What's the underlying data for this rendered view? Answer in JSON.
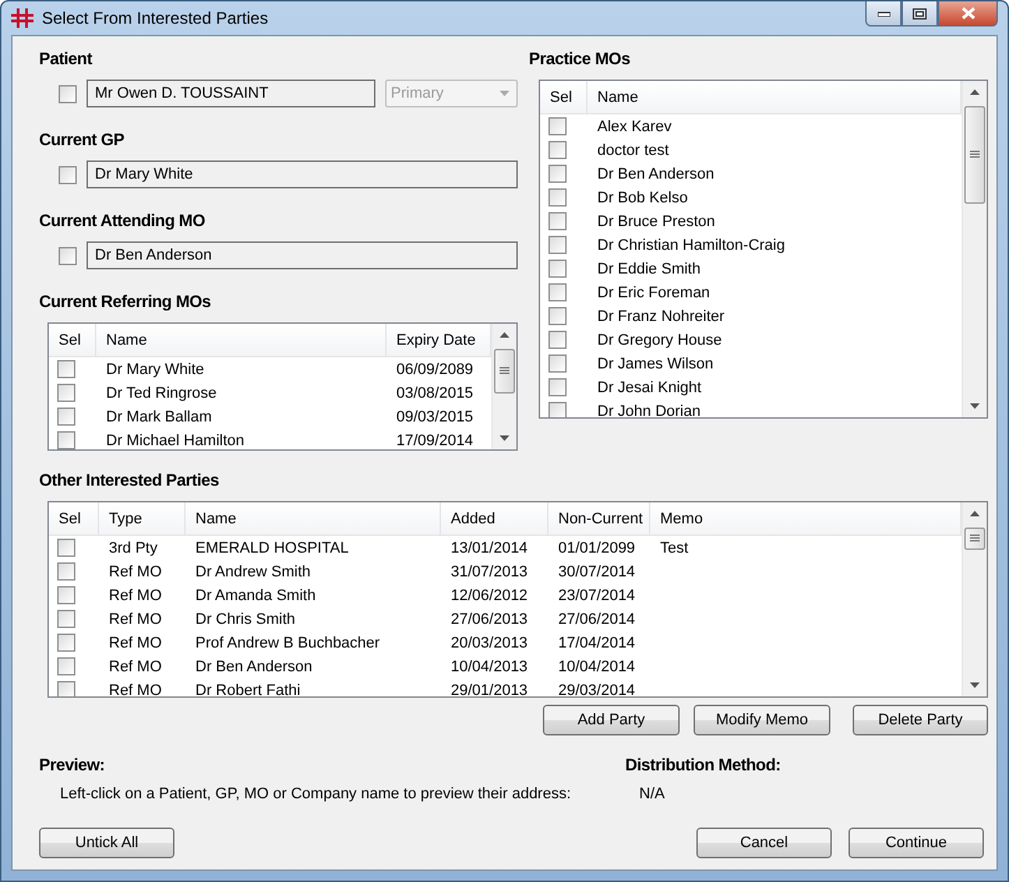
{
  "window": {
    "title": "Select From Interested Parties"
  },
  "patient": {
    "label": "Patient",
    "checked": false,
    "value": "Mr Owen D. TOUSSAINT",
    "address_type": {
      "value": "Primary",
      "disabled": true
    }
  },
  "current_gp": {
    "label": "Current GP",
    "checked": false,
    "value": "Dr Mary White"
  },
  "current_attending_mo": {
    "label": "Current Attending MO",
    "checked": false,
    "value": "Dr Ben Anderson"
  },
  "current_referring_mos": {
    "label": "Current Referring MOs",
    "columns": [
      "Sel",
      "Name",
      "Expiry Date"
    ],
    "rows": [
      {
        "checked": false,
        "name": "Dr Mary White",
        "expiry_date": "06/09/2089"
      },
      {
        "checked": false,
        "name": "Dr Ted Ringrose",
        "expiry_date": "03/08/2015"
      },
      {
        "checked": false,
        "name": "Dr Mark Ballam",
        "expiry_date": "09/03/2015"
      },
      {
        "checked": false,
        "name": "Dr Michael Hamilton",
        "expiry_date": "17/09/2014"
      }
    ]
  },
  "practice_mos": {
    "label": "Practice MOs",
    "columns": [
      "Sel",
      "Name"
    ],
    "rows": [
      {
        "checked": false,
        "name": "Alex Karev"
      },
      {
        "checked": false,
        "name": "doctor test"
      },
      {
        "checked": false,
        "name": "Dr Ben Anderson"
      },
      {
        "checked": false,
        "name": "Dr Bob Kelso"
      },
      {
        "checked": false,
        "name": "Dr Bruce Preston"
      },
      {
        "checked": false,
        "name": "Dr Christian Hamilton-Craig"
      },
      {
        "checked": false,
        "name": "Dr Eddie Smith"
      },
      {
        "checked": false,
        "name": "Dr Eric Foreman"
      },
      {
        "checked": false,
        "name": "Dr Franz Nohreiter"
      },
      {
        "checked": false,
        "name": "Dr Gregory House"
      },
      {
        "checked": false,
        "name": "Dr James Wilson"
      },
      {
        "checked": false,
        "name": "Dr Jesai Knight"
      },
      {
        "checked": false,
        "name": "Dr John Dorian"
      }
    ]
  },
  "other_interested_parties": {
    "label": "Other Interested Parties",
    "columns": [
      "Sel",
      "Type",
      "Name",
      "Added",
      "Non-Current",
      "Memo"
    ],
    "rows": [
      {
        "checked": false,
        "type": "3rd Pty",
        "name": "EMERALD HOSPITAL",
        "added": "13/01/2014",
        "non_current": "01/01/2099",
        "memo": "Test"
      },
      {
        "checked": false,
        "type": "Ref MO",
        "name": "Dr Andrew Smith",
        "added": "31/07/2013",
        "non_current": "30/07/2014"
      },
      {
        "checked": false,
        "type": "Ref MO",
        "name": "Dr Amanda Smith",
        "added": "12/06/2012",
        "non_current": "23/07/2014"
      },
      {
        "checked": false,
        "type": "Ref MO",
        "name": "Dr Chris Smith",
        "added": "27/06/2013",
        "non_current": "27/06/2014"
      },
      {
        "checked": false,
        "type": "Ref MO",
        "name": "Prof Andrew B Buchbacher",
        "added": "20/03/2013",
        "non_current": "17/04/2014"
      },
      {
        "checked": false,
        "type": "Ref MO",
        "name": "Dr Ben Anderson",
        "added": "10/04/2013",
        "non_current": "10/04/2014"
      },
      {
        "checked": false,
        "type": "Ref MO",
        "name": "Dr Robert Fathi",
        "added": "29/01/2013",
        "non_current": "29/03/2014"
      }
    ],
    "buttons": [
      "Add Party",
      "Modify Memo",
      "Delete Party"
    ]
  },
  "preview": {
    "label": "Preview:",
    "text": "Left-click on a Patient, GP, MO or Company name to preview their address:"
  },
  "distribution_method": {
    "label": "Distribution Method:",
    "value": "N/A"
  },
  "footer": {
    "left_buttons": [
      "Untick All"
    ],
    "right_buttons": [
      "Cancel",
      "Continue"
    ]
  }
}
